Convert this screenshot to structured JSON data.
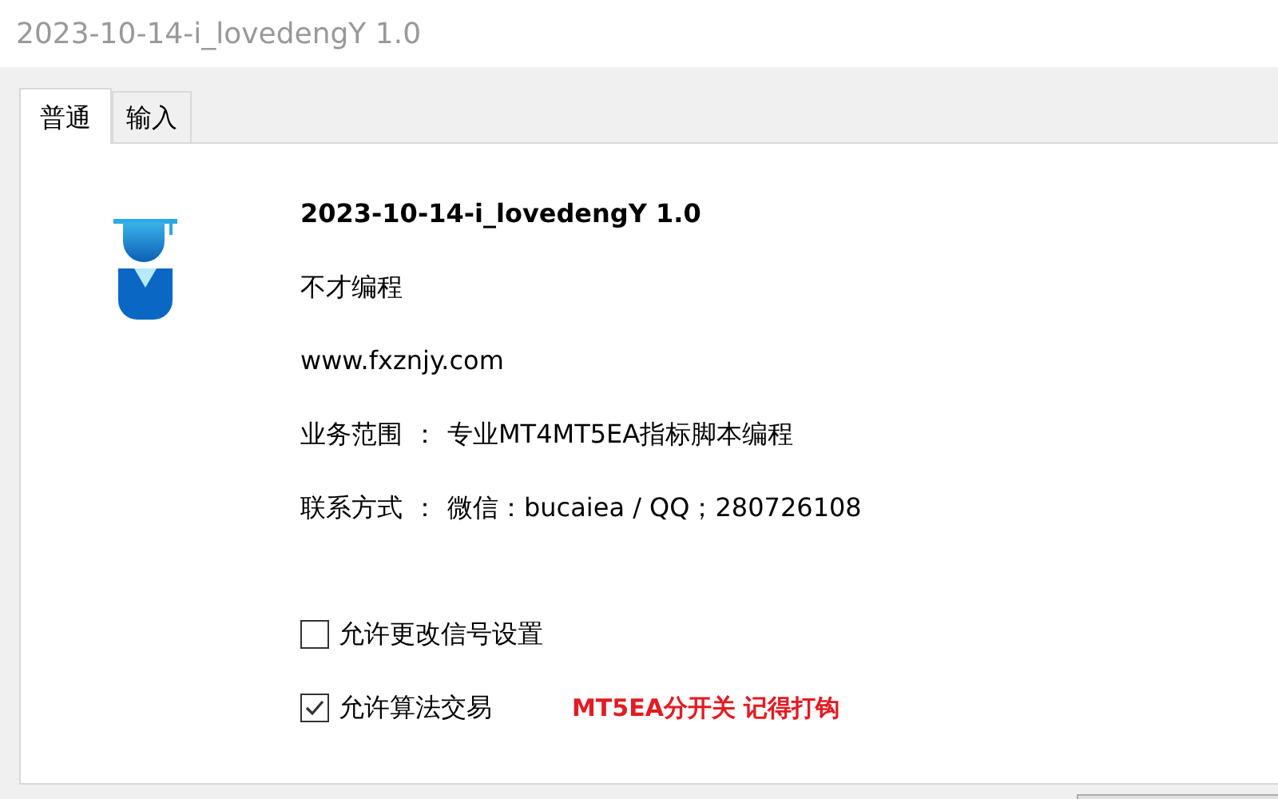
{
  "window": {
    "title": "2023-10-14-i_lovedengY 1.0"
  },
  "tabs": [
    {
      "label": "普通",
      "selected": true
    },
    {
      "label": "输入",
      "selected": false
    }
  ],
  "info": {
    "name": "2023-10-14-i_lovedengY 1.0",
    "author": "不才编程",
    "website": "www.fxznjy.com",
    "lines": [
      {
        "label": "业务范围",
        "separator": "：",
        "value": "专业MT4MT5EA指标脚本编程"
      },
      {
        "label": "联系方式",
        "separator": "：",
        "value": "微信：bucaiea / QQ；280726108"
      }
    ]
  },
  "options": [
    {
      "label": "允许更改信号设置",
      "checked": false
    },
    {
      "label": "允许算法交易",
      "checked": true,
      "note": "MT5EA分开关 记得打钩"
    }
  ]
}
